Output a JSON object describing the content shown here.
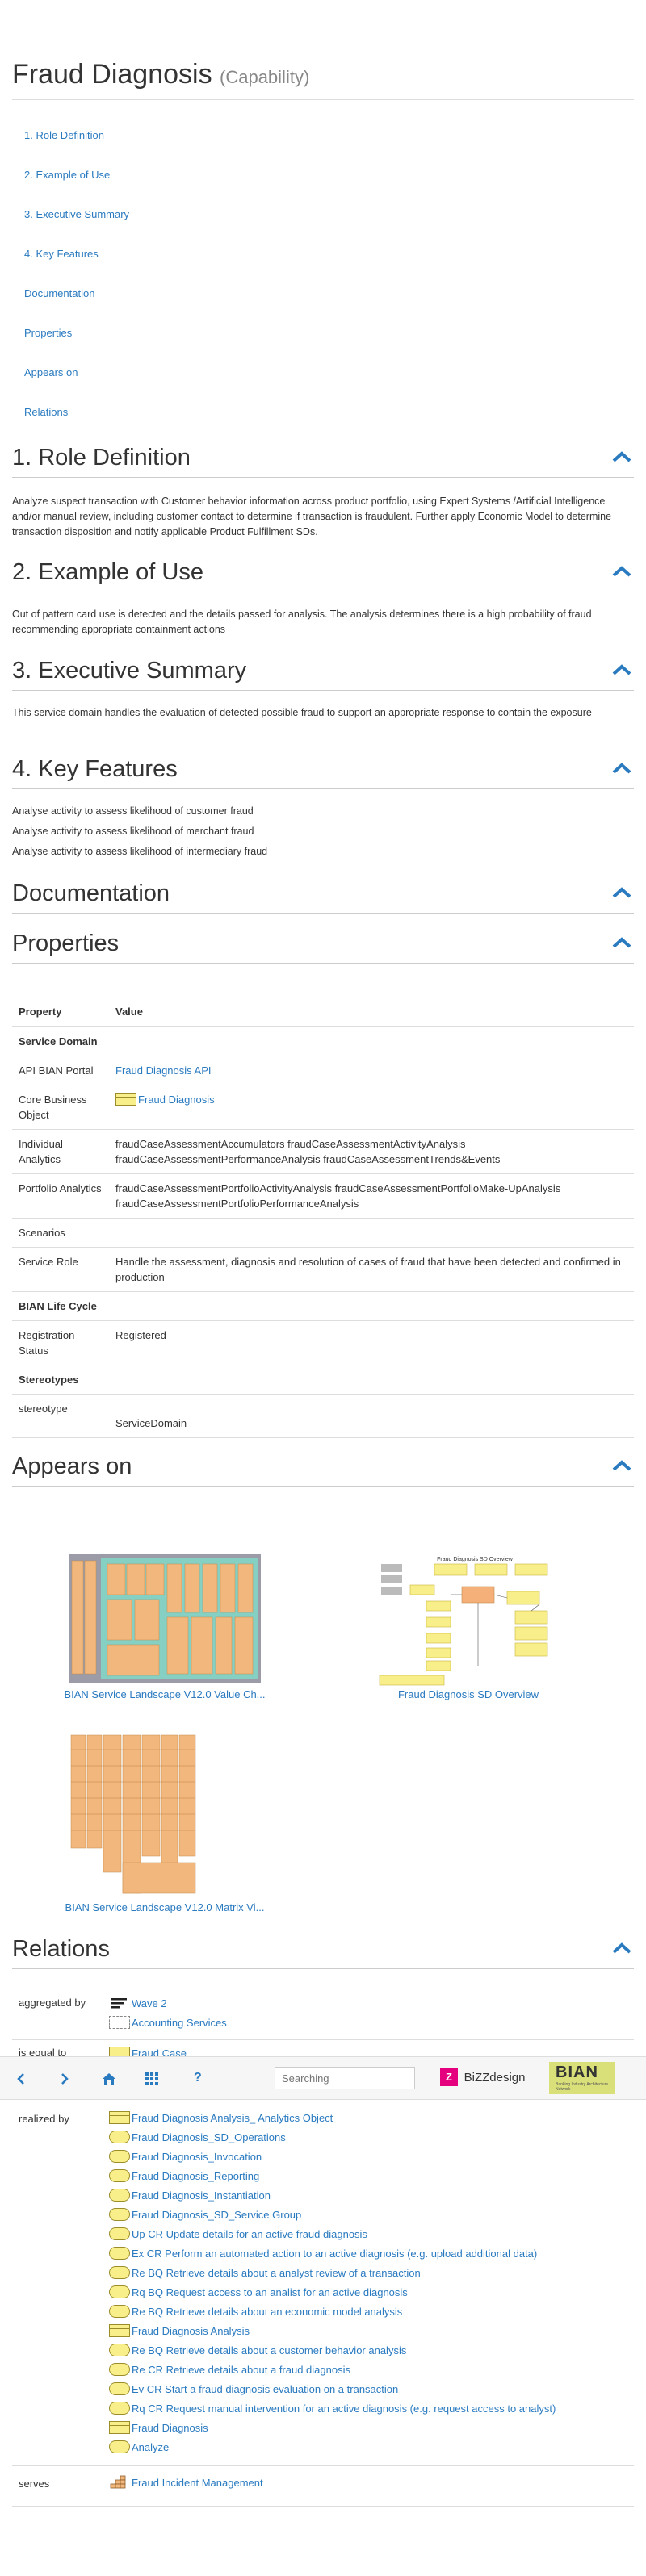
{
  "header": {
    "title": "Fraud Diagnosis",
    "subtitle": "(Capability)"
  },
  "toc": [
    "1. Role Definition",
    "2. Example of Use",
    "3. Executive Summary",
    "4. Key Features",
    "Documentation",
    "Properties",
    "Appears on",
    "Relations"
  ],
  "sections": {
    "role": {
      "title": "1. Role Definition",
      "text": "Analyze suspect transaction with Customer behavior information across product portfolio, using Expert Systems /Artificial Intelligence and/or manual review, including customer contact to determine if transaction is fraudulent.  Further apply Economic Model to determine transaction disposition and notify applicable Product Fulfillment SDs."
    },
    "example": {
      "title": "2. Example of Use",
      "text": "Out of pattern card use is detected and the details passed for analysis. The analysis determines there is a high probability of fraud recommending appropriate containment actions"
    },
    "summary": {
      "title": "3. Executive Summary",
      "text": "This service domain handles the evaluation of detected possible fraud to support an appropriate response to contain the exposure"
    },
    "features": {
      "title": "4. Key Features",
      "items": [
        "Analyse activity to assess likelihood of customer fraud",
        "Analyse activity to assess likelihood of merchant fraud",
        "Analyse activity to assess likelihood of intermediary fraud"
      ]
    },
    "documentation": {
      "title": "Documentation"
    },
    "properties": {
      "title": "Properties"
    },
    "appears": {
      "title": "Appears on"
    },
    "relations": {
      "title": "Relations"
    }
  },
  "properties": {
    "col_property": "Property",
    "col_value": "Value",
    "group_service_domain": "Service Domain",
    "api_label": "API BIAN Portal",
    "api_value": "Fraud Diagnosis API",
    "cbo_label": "Core Business Object",
    "cbo_value": "Fraud Diagnosis",
    "ia_label": "Individual Analytics",
    "ia_value": "fraudCaseAssessmentAccumulators fraudCaseAssessmentActivityAnalysis fraudCaseAssessmentPerformanceAnalysis fraudCaseAssessmentTrends&Events",
    "pa_label": "Portfolio Analytics",
    "pa_value": "fraudCaseAssessmentPortfolioActivityAnalysis fraudCaseAssessmentPortfolioMake-UpAnalysis fraudCaseAssessmentPortfolioPerformanceAnalysis",
    "scen_label": "Scenarios",
    "role_label": "Service Role",
    "role_value": "Handle the assessment, diagnosis and resolution of cases of fraud that have been detected and confirmed in production",
    "group_lifecycle": "BIAN Life Cycle",
    "reg_label": "Registration Status",
    "reg_value": "Registered",
    "group_stereotypes": "Stereotypes",
    "stereo_label": "stereotype",
    "stereo_value": "ServiceDomain"
  },
  "appears_on": [
    "BIAN Service Landscape V12.0 Value Ch...",
    "Fraud Diagnosis SD Overview",
    "BIAN Service Landscape V12.0 Matrix Vi..."
  ],
  "thumbnail_text": {
    "overview_title": "Fraud Diagnosis SD Overview"
  },
  "relations": {
    "aggregated_label": "aggregated by",
    "aggregated": [
      "Wave 2",
      "Accounting Services"
    ],
    "equal_label": "is equal to",
    "equal": [
      "Fraud Case"
    ],
    "realized_label": "realized by",
    "realized": [
      {
        "icon": "bo",
        "text": "Fraud Diagnosis Analysis_ Analytics Object"
      },
      {
        "icon": "oval",
        "text": "Fraud Diagnosis_SD_Operations"
      },
      {
        "icon": "oval",
        "text": "Fraud Diagnosis_Invocation"
      },
      {
        "icon": "oval",
        "text": "Fraud Diagnosis_Reporting"
      },
      {
        "icon": "oval",
        "text": "Fraud Diagnosis_Instantiation"
      },
      {
        "icon": "oval",
        "text": "Fraud Diagnosis_SD_Service Group"
      },
      {
        "icon": "oval",
        "text": "Up CR Update details for an active fraud diagnosis"
      },
      {
        "icon": "oval",
        "text": "Ex CR Perform an automated action to an active diagnosis (e.g. upload additional data)"
      },
      {
        "icon": "oval",
        "text": "Re BQ Retrieve details about a analyst review of a transaction"
      },
      {
        "icon": "oval",
        "text": "Rq BQ Request access to an analist for an active diagnosis"
      },
      {
        "icon": "oval",
        "text": "Re BQ Retrieve details about an economic model analysis"
      },
      {
        "icon": "bo",
        "text": "Fraud Diagnosis Analysis"
      },
      {
        "icon": "oval",
        "text": "Re BQ Retrieve details about a customer behavior analysis"
      },
      {
        "icon": "oval",
        "text": "Re CR Retrieve details about a fraud diagnosis"
      },
      {
        "icon": "oval",
        "text": "Ev CR Start a fraud diagnosis evaluation on a transaction"
      },
      {
        "icon": "oval",
        "text": "Rq CR Request manual intervention for an active diagnosis (e.g. request access to analyst)"
      },
      {
        "icon": "bo",
        "text": "Fraud Diagnosis"
      },
      {
        "icon": "half",
        "text": "Analyze"
      }
    ],
    "serves_label": "serves",
    "serves": [
      "Fraud Incident Management"
    ]
  },
  "navbar": {
    "search_placeholder": "Searching",
    "help_label": "?",
    "bizz_label": "BiZZdesign",
    "bian_label": "BIAN",
    "bian_tagline": "Banking Industry Architecture Network"
  },
  "colors": {
    "link": "#2a7ac0",
    "accent_chevron": "#2a7ac0",
    "bian_green": "#d9e07a",
    "bizz_pink": "#e5007e"
  }
}
